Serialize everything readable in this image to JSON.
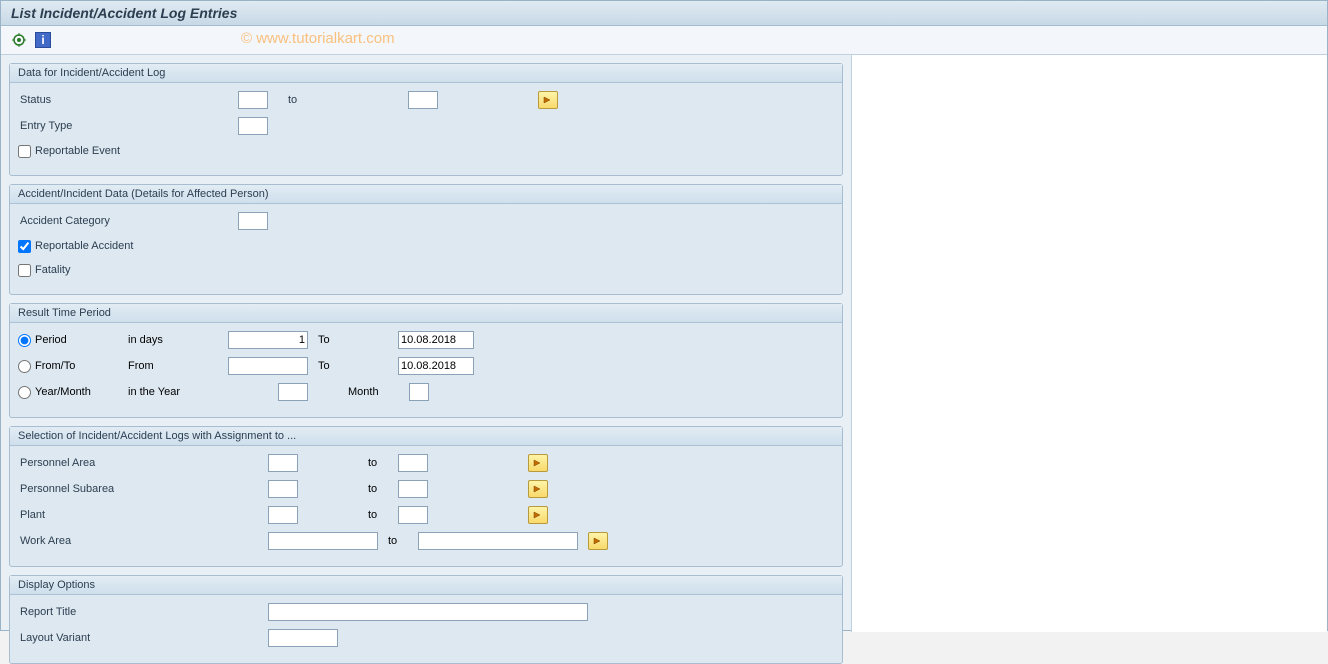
{
  "title": "List Incident/Accident Log Entries",
  "watermark": "© www.tutorialkart.com",
  "groups": {
    "data_log": {
      "title": "Data for Incident/Accident Log",
      "status_label": "Status",
      "status_from": "",
      "status_to_label": "to",
      "status_to": "",
      "entry_type_label": "Entry Type",
      "entry_type": "",
      "reportable_event_label": "Reportable Event",
      "reportable_event_checked": false
    },
    "affected_person": {
      "title": "Accident/Incident Data (Details for Affected Person)",
      "accident_category_label": "Accident Category",
      "accident_category": "",
      "reportable_accident_label": "Reportable Accident",
      "reportable_accident_checked": true,
      "fatality_label": "Fatality",
      "fatality_checked": false
    },
    "time_period": {
      "title": "Result Time Period",
      "period_label": "Period",
      "period_days_label": "in days",
      "period_days": "1",
      "period_to_label": "To",
      "period_to": "10.08.2018",
      "fromto_label": "From/To",
      "from_label": "From",
      "from_value": "",
      "fromto_to_label": "To",
      "fromto_to_value": "10.08.2018",
      "yearmonth_label": "Year/Month",
      "year_label": "in the Year",
      "year_value": "",
      "month_label": "Month",
      "month_value": "",
      "selected": "period"
    },
    "selection": {
      "title": "Selection of Incident/Accident Logs with Assignment to ...",
      "personnel_area_label": "Personnel Area",
      "personnel_area_from": "",
      "personnel_area_to": "",
      "personnel_subarea_label": "Personnel Subarea",
      "personnel_subarea_from": "",
      "personnel_subarea_to": "",
      "plant_label": "Plant",
      "plant_from": "",
      "plant_to": "",
      "work_area_label": "Work Area",
      "work_area_from": "",
      "work_area_to": "",
      "to_label": "to"
    },
    "display": {
      "title": "Display Options",
      "report_title_label": "Report Title",
      "report_title": "",
      "layout_variant_label": "Layout Variant",
      "layout_variant": ""
    }
  }
}
